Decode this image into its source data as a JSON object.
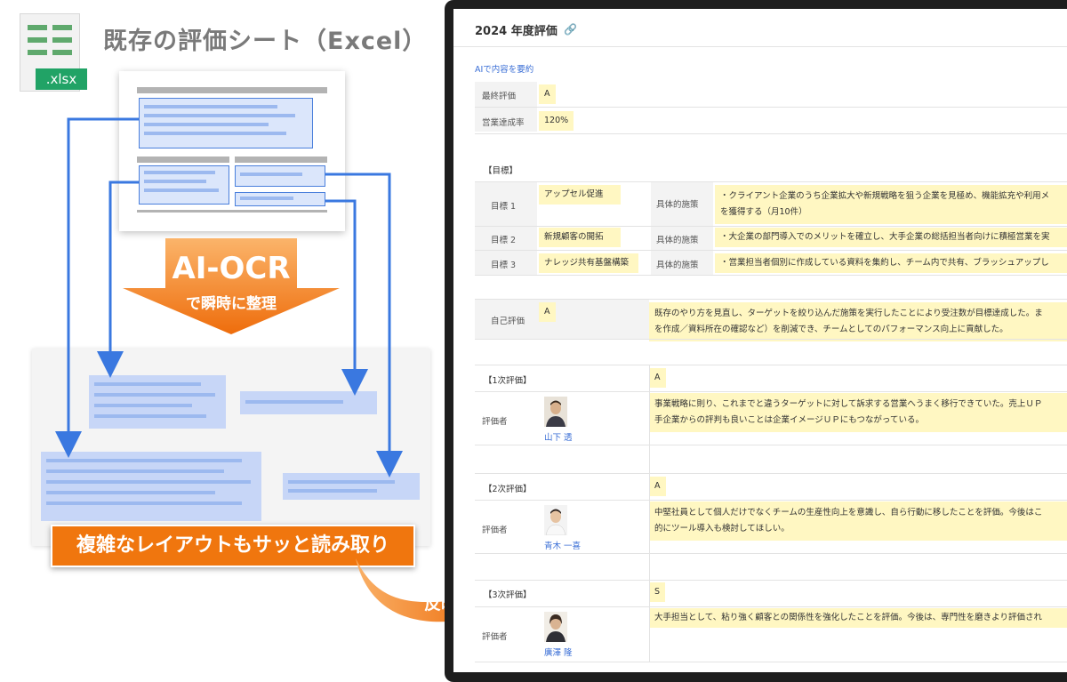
{
  "left": {
    "file_tag": ".xlsx",
    "title": "既存の評価シート（Excel）",
    "ai_ocr": "AI-OCR",
    "ai_sub": "で瞬時に整理",
    "banner": "複雑なレイアウトもサッと読み取り",
    "reflect": "反映"
  },
  "screen": {
    "title": "2024 年度評価",
    "ai_summary": "AIで内容を要約",
    "final_label": "最終評価",
    "final_value": "A",
    "sales_label": "営業達成率",
    "sales_value": "120%",
    "goals_section": "【目標】",
    "goals": [
      {
        "label": "目標 1",
        "name": "アップセル促進",
        "measure_label": "具体的施策",
        "measure_line1": "・クライアント企業のうち企業拡大や新規戦略を狙う企業を見極め、機能拡充や利用メ",
        "measure_line2": "を獲得する（月10件）"
      },
      {
        "label": "目標 2",
        "name": "新規顧客の開拓",
        "measure_label": "具体的施策",
        "measure_line1": "・大企業の部門導入でのメリットを確立し、大手企業の総括担当者向けに積極営業を実",
        "measure_line2": ""
      },
      {
        "label": "目標 3",
        "name": "ナレッジ共有基盤構築",
        "measure_label": "具体的施策",
        "measure_line1": "・営業担当者個別に作成している資料を集約し、チーム内で共有、ブラッシュアップし",
        "measure_line2": ""
      }
    ],
    "self_label": "自己評価",
    "self_value": "A",
    "self_comment_line1": "既存のやり方を見直し、ターゲットを絞り込んだ施策を実行したことにより受注数が目標達成した。ま",
    "self_comment_line2": "を作成／資料所在の確認など）を削減でき、チームとしてのパフォーマンス向上に貢献した。",
    "evaluations": [
      {
        "section": "【1次評価】",
        "grade": "A",
        "evaluator_label": "評価者",
        "person": "山下 透",
        "line1": "事業戦略に則り、これまでと違うターゲットに対して訴求する営業へうまく移行できていた。売上ＵＰ",
        "line2": "手企業からの評判も良いことは企業イメージＵＰにもつながっている。"
      },
      {
        "section": "【2次評価】",
        "grade": "A",
        "evaluator_label": "評価者",
        "person": "青木 一喜",
        "line1": "中堅社員として個人だけでなくチームの生産性向上を意識し、自ら行動に移したことを評価。今後はこ",
        "line2": "的にツール導入も検討してほしい。"
      },
      {
        "section": "【3次評価】",
        "grade": "S",
        "evaluator_label": "評価者",
        "person": "廣澤 隆",
        "line1": "大手担当として、粘り強く顧客との関係性を強化したことを評価。今後は、専門性を磨きより評価され",
        "line2": ""
      }
    ]
  }
}
